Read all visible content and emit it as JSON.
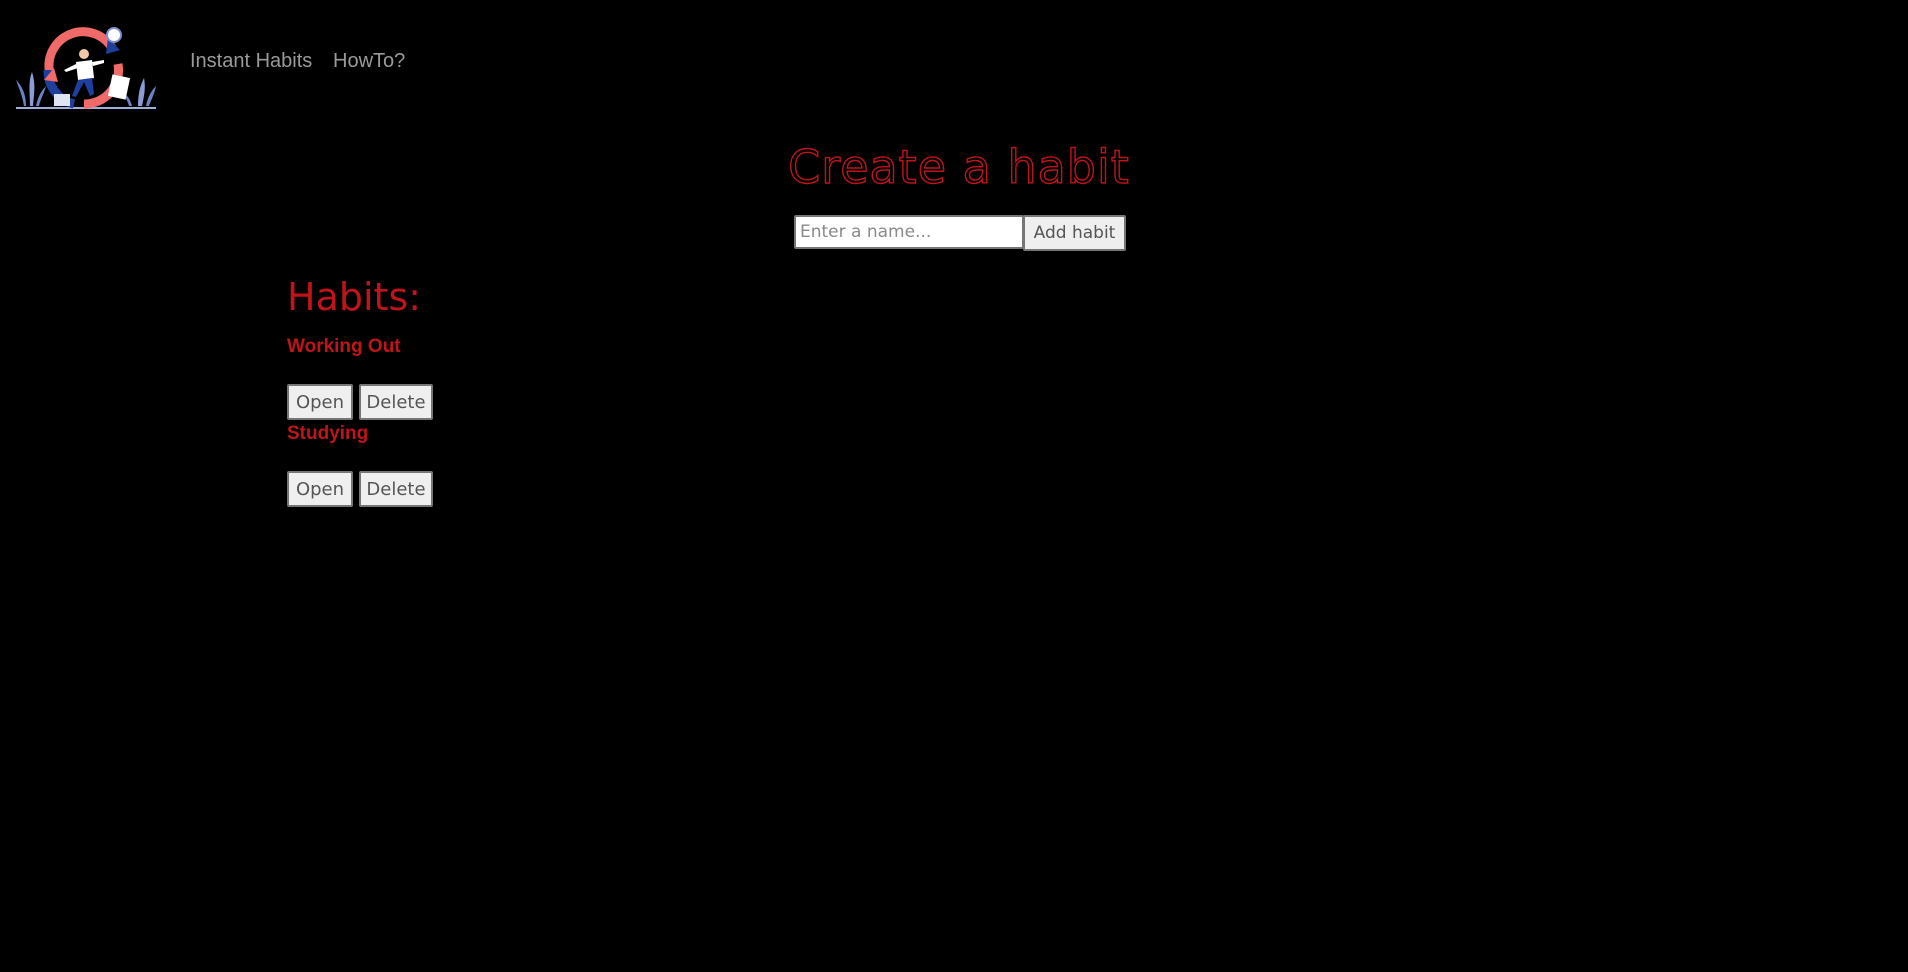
{
  "app": {
    "brand_colors": {
      "accent": "#c0141b",
      "background": "#000000",
      "nav_text": "#9a9a9a",
      "button_bg": "#efefef"
    }
  },
  "nav": {
    "logo_icon": "habit-cycle-illustration-icon",
    "links": [
      {
        "label": "Instant Habits"
      },
      {
        "label": "HowTo?"
      }
    ]
  },
  "create": {
    "title": "Create a habit",
    "input_placeholder": "Enter a name...",
    "input_value": "",
    "add_label": "Add habit"
  },
  "habits": {
    "title": "Habits:",
    "items": [
      {
        "name": "Working Out",
        "open_label": "Open",
        "delete_label": "Delete"
      },
      {
        "name": "Studying",
        "open_label": "Open",
        "delete_label": "Delete"
      }
    ]
  }
}
